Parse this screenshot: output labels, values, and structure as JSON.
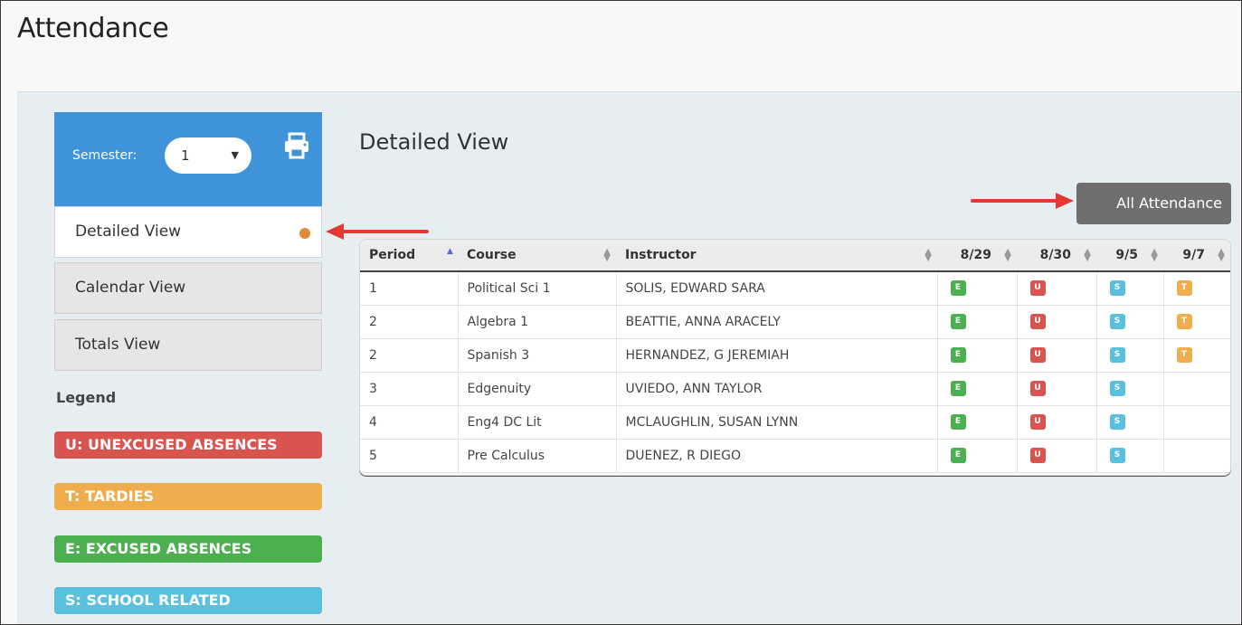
{
  "page": {
    "title": "Attendance"
  },
  "sidebar": {
    "semester_label": "Semester:",
    "semester_value": "1",
    "nav": [
      "Detailed View",
      "Calendar View",
      "Totals View"
    ],
    "legend_title": "Legend",
    "legend": [
      {
        "label": "U: UNEXCUSED ABSENCES",
        "color": "#d9534f"
      },
      {
        "label": "T: TARDIES",
        "color": "#f0ad4e"
      },
      {
        "label": "E: EXCUSED ABSENCES",
        "color": "#4caf50"
      },
      {
        "label": "S: SCHOOL RELATED",
        "color": "#5bc0de"
      }
    ]
  },
  "main": {
    "title": "Detailed View",
    "all_attendance_label": "All Attendance",
    "columns": [
      "Period",
      "Course",
      "Instructor",
      "8/29",
      "8/30",
      "9/5",
      "9/7"
    ],
    "rows": [
      {
        "period": "1",
        "course": "Political Sci 1",
        "instructor": "SOLIS, EDWARD SARA",
        "marks": [
          "E",
          "U",
          "S",
          "T"
        ]
      },
      {
        "period": "2",
        "course": "Algebra 1",
        "instructor": "BEATTIE, ANNA ARACELY",
        "marks": [
          "E",
          "U",
          "S",
          "T"
        ]
      },
      {
        "period": "2",
        "course": "Spanish 3",
        "instructor": "HERNANDEZ, G JEREMIAH",
        "marks": [
          "E",
          "U",
          "S",
          "T"
        ]
      },
      {
        "period": "3",
        "course": "Edgenuity",
        "instructor": "UVIEDO, ANN TAYLOR",
        "marks": [
          "E",
          "U",
          "S",
          ""
        ]
      },
      {
        "period": "4",
        "course": "Eng4 DC Lit",
        "instructor": "MCLAUGHLIN, SUSAN LYNN",
        "marks": [
          "E",
          "U",
          "S",
          ""
        ]
      },
      {
        "period": "5",
        "course": "Pre Calculus",
        "instructor": "DUENEZ, R DIEGO",
        "marks": [
          "E",
          "U",
          "S",
          ""
        ]
      }
    ]
  },
  "colors": {
    "accent": "#3e93d9",
    "arrow": "#e53935",
    "active_dot": "#e08a3a",
    "button": "#6f6f6f"
  }
}
